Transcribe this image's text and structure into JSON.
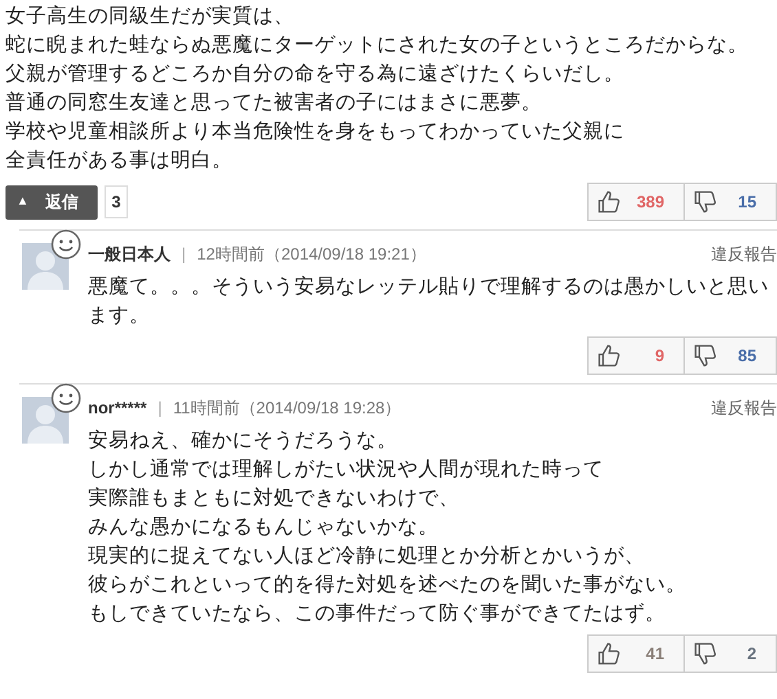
{
  "comment": {
    "lines": [
      "女子高生の同級生だが実質は、",
      "蛇に睨まれた蛙ならぬ悪魔にターゲットにされた女の子というところだからな。",
      "父親が管理するどころか自分の命を守る為に遠ざけたくらいだし。",
      "普通の同窓生友達と思ってた被害者の子にはまさに悪夢。",
      "学校や児童相談所より本当危険性を身をもってわかっていた父親に",
      "全責任がある事は明白。"
    ],
    "reply_button": {
      "icon": "▲",
      "label": "返信",
      "expanded": true
    },
    "reply_count": "3",
    "votes": [
      {
        "kind": "like",
        "count": "389",
        "color": "#e06666"
      },
      {
        "kind": "dislike",
        "count": "15",
        "color": "#4a6ea9"
      }
    ]
  },
  "replies": [
    {
      "author": "一般日本人",
      "separator": "|",
      "time": "12時間前（2014/09/18 19:21）",
      "report": "違反報告",
      "lines": [
        "悪魔て。。。そういう安易なレッテル貼りで理解するのは愚かしいと思い",
        "ます。"
      ],
      "votes": [
        {
          "kind": "like",
          "count": "9",
          "color": "#e06666"
        },
        {
          "kind": "dislike",
          "count": "85",
          "color": "#4a6ea9"
        }
      ]
    },
    {
      "author": "nor*****",
      "separator": "|",
      "time": "11時間前（2014/09/18 19:28）",
      "report": "違反報告",
      "lines": [
        "安易ねえ、確かにそうだろうな。",
        "しかし通常では理解しがたい状況や人間が現れた時って",
        "実際誰もまともに対処できないわけで、",
        "みんな愚かになるもんじゃないかな。",
        "現実的に捉えてない人ほど冷静に処理とか分析とかいうが、",
        "彼らがこれといって的を得た対処を述べたのを聞いた事がない。",
        "もしできていたなら、この事件だって防ぐ事ができてたはず。"
      ],
      "votes": [
        {
          "kind": "like",
          "count": "41",
          "color": "#8a7f78"
        },
        {
          "kind": "dislike",
          "count": "2",
          "color": "#6a7480"
        }
      ]
    }
  ]
}
